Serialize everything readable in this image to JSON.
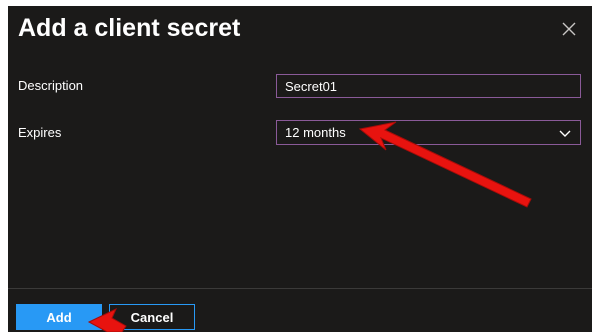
{
  "dialog": {
    "title": "Add a client secret",
    "close_icon": "close-icon"
  },
  "form": {
    "description": {
      "label": "Description",
      "value": "Secret01"
    },
    "expires": {
      "label": "Expires",
      "selected": "12 months",
      "chevron_icon": "chevron-down-icon"
    }
  },
  "footer": {
    "add_label": "Add",
    "cancel_label": "Cancel"
  },
  "colors": {
    "panel_background": "#1b1a19",
    "input_border": "#8a5a98",
    "primary_button": "#2899f5",
    "annotation_arrow": "#e8130f"
  }
}
